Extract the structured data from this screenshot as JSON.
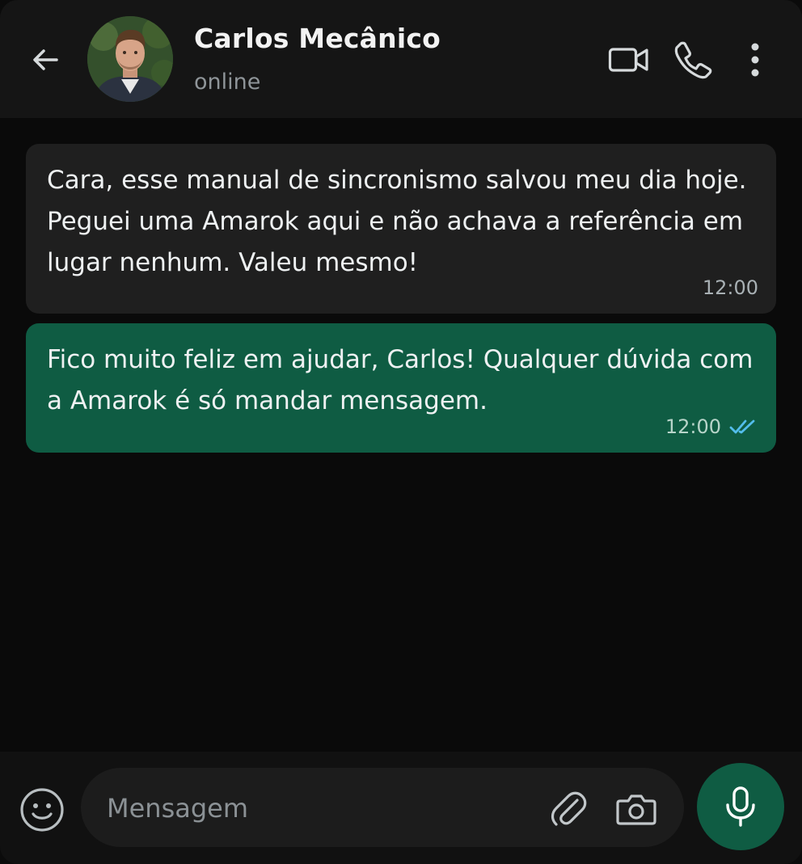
{
  "header": {
    "contact_name": "Carlos Mecânico",
    "status": "online",
    "icons": {
      "back": "arrow-left-icon",
      "video": "video-camera-icon",
      "call": "phone-icon",
      "menu": "more-vertical-icon"
    }
  },
  "messages": [
    {
      "direction": "incoming",
      "text": "Cara, esse manual de sincronismo salvou meu dia hoje. Peguei uma Amarok aqui e não achava a referência em lugar nenhum. Valeu mesmo!",
      "time": "12:00"
    },
    {
      "direction": "outgoing",
      "text": "Fico muito feliz em ajudar, Carlos! Qualquer dúvida com a Amarok é só mandar mensagem.",
      "time": "12:00",
      "read_receipt": "double-check-icon"
    }
  ],
  "composer": {
    "value": "",
    "placeholder": "Mensagem",
    "icons": {
      "emoji": "emoji-icon",
      "attach": "paperclip-icon",
      "camera": "camera-icon",
      "mic": "microphone-icon"
    }
  },
  "colors": {
    "header_bg": "#151515",
    "chat_bg": "#0a0a0a",
    "incoming_bubble": "#1f1f1f",
    "outgoing_bubble": "#0f5c43",
    "read_check": "#53bdeb",
    "mic_button": "#0f5c43"
  }
}
